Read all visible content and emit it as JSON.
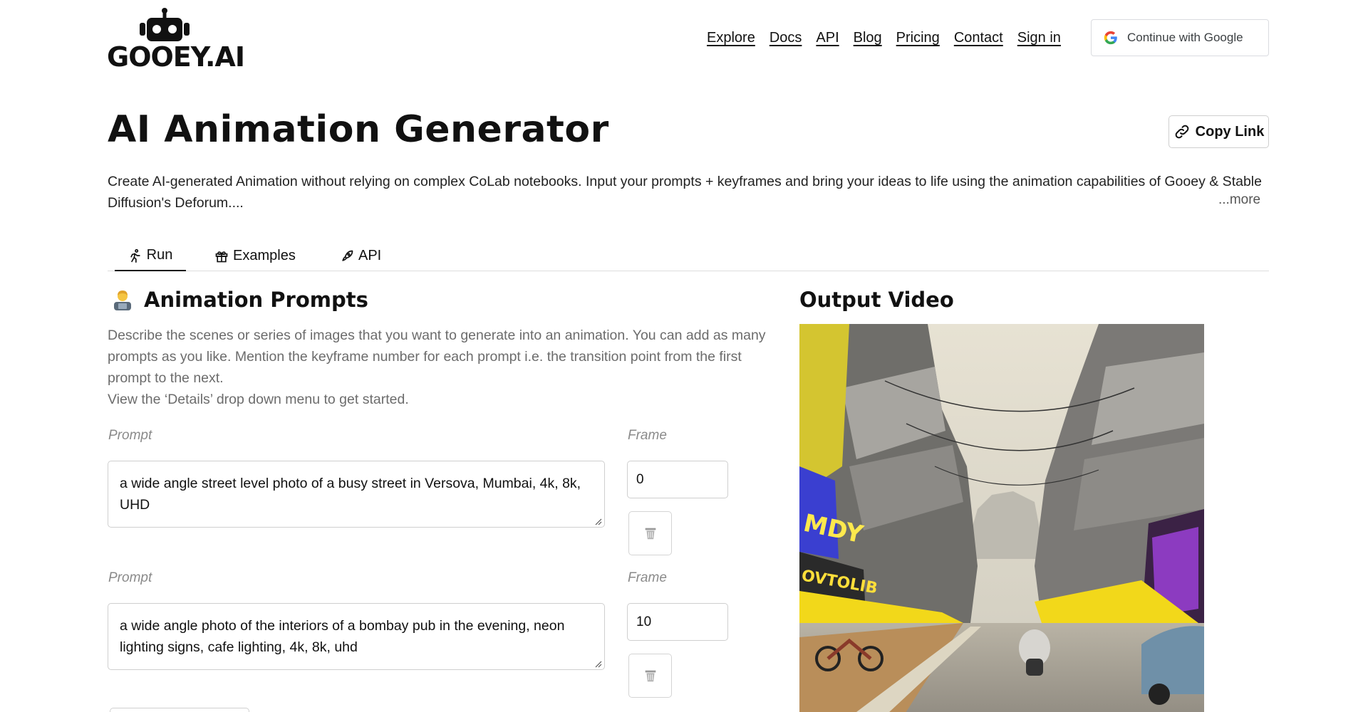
{
  "brand": {
    "name": "GOOEY.AI"
  },
  "nav": {
    "items": [
      "Explore",
      "Docs",
      "API",
      "Blog",
      "Pricing",
      "Contact",
      "Sign in"
    ],
    "google_button": "Continue with Google"
  },
  "page": {
    "title": "AI Animation Generator",
    "copy_link": "Copy Link",
    "description": "Create AI-generated Animation without relying on complex CoLab notebooks. Input your prompts + keyframes and bring your ideas to life using the animation capabilities of Gooey & Stable Diffusion's Deforum....",
    "more": "...more"
  },
  "tabs": [
    {
      "label": "Run",
      "icon": "runner-icon",
      "active": true
    },
    {
      "label": "Examples",
      "icon": "gift-icon",
      "active": false
    },
    {
      "label": "API",
      "icon": "rocket-icon",
      "active": false
    }
  ],
  "animation_prompts": {
    "title": "Animation Prompts",
    "icon": "technologist-emoji-icon",
    "help_lines": [
      "Describe the scenes or series of images that you want to generate into an animation. You can add as many prompts as you like. Mention the keyframe number for each prompt i.e. the transition point from the first prompt to the next.",
      "View the ‘Details’ drop down menu to get started."
    ],
    "prompt_label": "Prompt",
    "frame_label": "Frame",
    "rows": [
      {
        "prompt": "a wide angle street level photo of a busy street in Versova, Mumbai, 4k, 8k, UHD",
        "frame": "0"
      },
      {
        "prompt": "a wide angle photo of the interiors of a bombay pub in the evening, neon lighting signs, cafe lighting, 4k, 8k, uhd",
        "frame": "10"
      }
    ]
  },
  "output": {
    "title": "Output Video",
    "sign_texts": [
      "MDY",
      "OVTOLIB"
    ]
  },
  "colors": {
    "text": "#111111",
    "muted": "#6c6c6c",
    "border": "#cfcfcf",
    "neon_yellow": "#f2d81a",
    "neon_purple": "#9b3fd6"
  }
}
